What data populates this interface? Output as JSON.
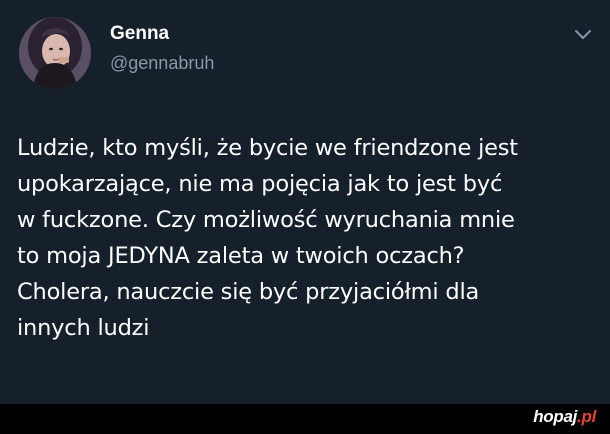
{
  "tweet": {
    "author_name": "Genna",
    "author_handle": "@gennabruh",
    "lines": [
      "Ludzie, kto myśli, że bycie we friendzone jest",
      "upokarzające, nie ma pojęcia jak to jest być",
      "w fuckzone. Czy możliwość wyruchania mnie",
      "to moja JEDYNA zaleta w twoich oczach?",
      "Cholera, nauczcie się być przyjaciółmi dla",
      "innych ludzi"
    ],
    "menu_icon": "chevron-down-icon",
    "avatar_icon": "avatar"
  },
  "watermark": {
    "name": "hopaj",
    "dot": ".",
    "tld": "pl"
  },
  "colors": {
    "background": "#15202b",
    "text": "#ffffff",
    "secondary_text": "#8899a6",
    "footer": "#000000",
    "watermark_accent": "#e8412a"
  }
}
